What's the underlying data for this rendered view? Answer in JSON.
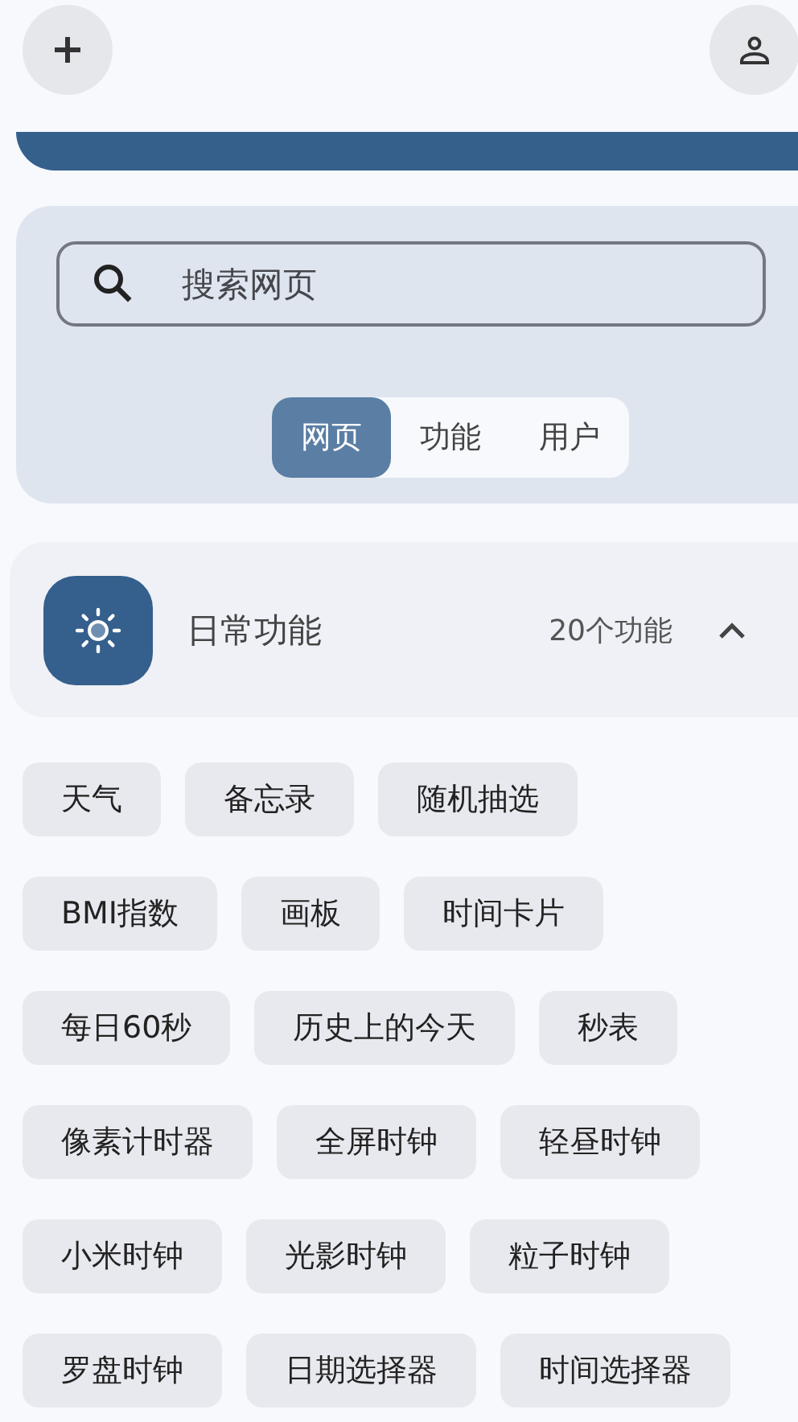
{
  "search": {
    "placeholder": "搜索网页"
  },
  "scopes": [
    {
      "label": "网页",
      "selected": true
    },
    {
      "label": "功能",
      "selected": false
    },
    {
      "label": "用户",
      "selected": false
    }
  ],
  "category": {
    "title": "日常功能",
    "count": "20个功能",
    "expanded": true
  },
  "tools": [
    [
      "天气",
      "备忘录",
      "随机抽选"
    ],
    [
      "BMI指数",
      "画板",
      "时间卡片"
    ],
    [
      "每日60秒",
      "历史上的今天",
      "秒表"
    ],
    [
      "像素计时器",
      "全屏时钟",
      "轻昼时钟"
    ],
    [
      "小米时钟",
      "光影时钟",
      "粒子时钟"
    ],
    [
      "罗盘时钟",
      "日期选择器",
      "时间选择器"
    ]
  ]
}
